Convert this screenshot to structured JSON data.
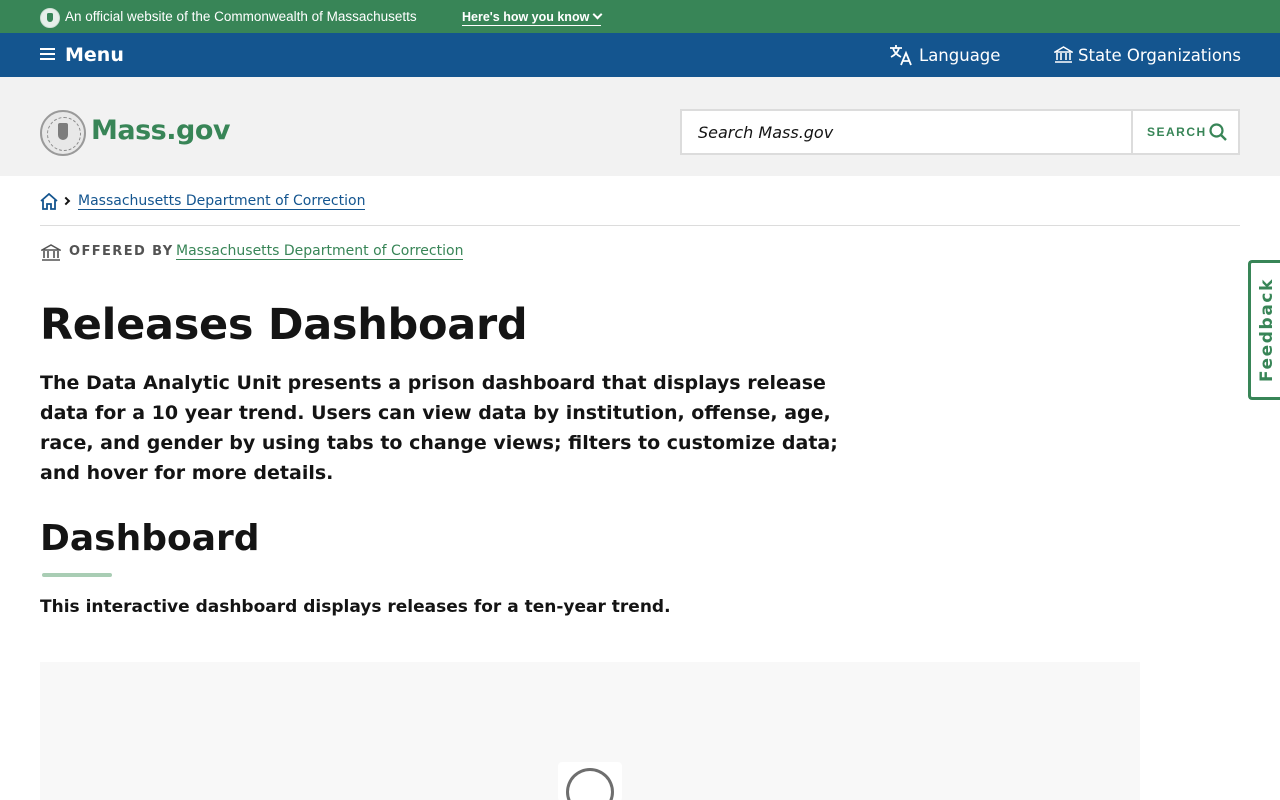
{
  "official_banner": {
    "text": "An official website of the Commonwealth of Massachusetts",
    "how_you_know": "Here's how you know"
  },
  "utility_nav": {
    "menu_label": "Menu",
    "language_label": "Language",
    "state_orgs_label": "State Organizations"
  },
  "header": {
    "logo_text": "Mass.gov",
    "search_placeholder": "Search Mass.gov",
    "search_button_label": "SEARCH"
  },
  "breadcrumb": {
    "items": [
      "Massachusetts Department of Correction"
    ]
  },
  "offered_by": {
    "label": "OFFERED BY",
    "organization": "Massachusetts Department of Correction"
  },
  "main": {
    "page_title": "Releases Dashboard",
    "lede": "The Data Analytic Unit presents a prison dashboard that displays release data for a 10 year trend. Users can view data by institution, offense, age, race, and gender by using tabs to change views; filters to customize data; and hover for more details.",
    "section_title": "Dashboard",
    "section_description": "This interactive dashboard displays releases for a ten-year trend."
  },
  "feedback_label": "Feedback",
  "colors": {
    "banner_green": "#388557",
    "nav_blue": "#14558f",
    "header_gray": "#f2f2f2",
    "link_blue": "#14558f",
    "link_green": "#388557"
  },
  "icons": [
    "shield-seal-icon",
    "chevron-down-icon",
    "hamburger-icon",
    "translate-icon",
    "building-icon",
    "search-icon",
    "home-icon",
    "chevron-right-icon",
    "loading-spinner-icon"
  ]
}
